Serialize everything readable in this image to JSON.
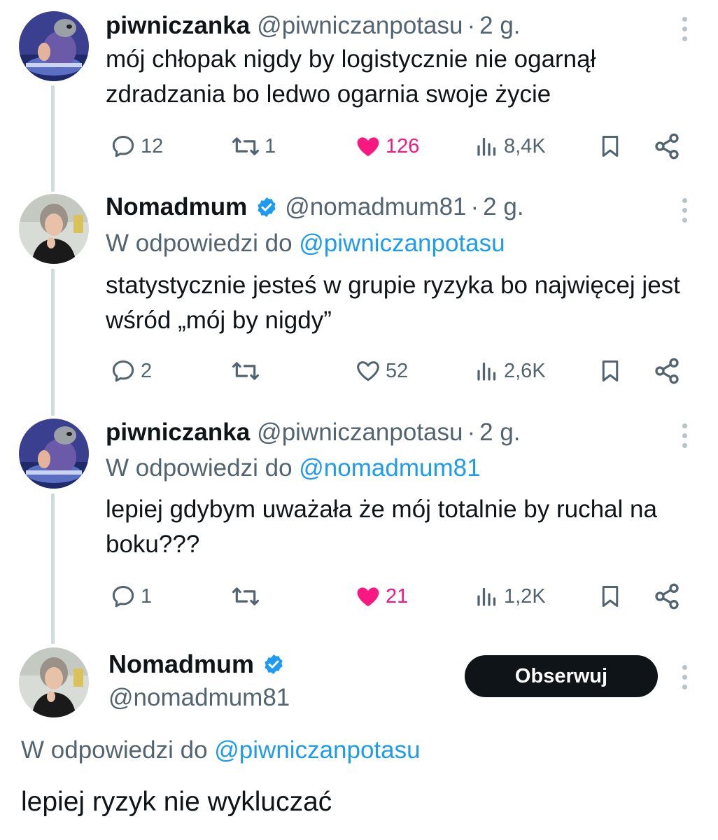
{
  "tweets": [
    {
      "name": "piwniczanka",
      "handle": "@piwniczanpotasu",
      "dot": "·",
      "time": "2 g.",
      "reply_prefix": "",
      "reply_mention": "",
      "text": "mój chłopak nigdy by logistycznie nie ogarnął zdradzania bo ledwo ogarnia swoje życie",
      "replies": "12",
      "retweets": "1",
      "likes": "126",
      "views": "8,4K",
      "liked": true,
      "verified": false
    },
    {
      "name": "Nomadmum",
      "handle": "@nomadmum81",
      "dot": "·",
      "time": "2 g.",
      "reply_prefix": "W odpowiedzi do",
      "reply_mention": "@piwniczanpotasu",
      "text": "statystycznie jesteś w grupie ryzyka bo najwięcej jest wśród „mój by nigdy”",
      "replies": "2",
      "retweets": "",
      "likes": "52",
      "views": "2,6K",
      "liked": false,
      "verified": true
    },
    {
      "name": "piwniczanka",
      "handle": "@piwniczanpotasu",
      "dot": "·",
      "time": "2 g.",
      "reply_prefix": "W odpowiedzi do",
      "reply_mention": "@nomadmum81",
      "text": "lepiej gdybym uważała że mój totalnie by ruchal na boku???",
      "replies": "1",
      "retweets": "",
      "likes": "21",
      "views": "1,2K",
      "liked": true,
      "verified": false
    }
  ],
  "main": {
    "name": "Nomadmum",
    "handle": "@nomadmum81",
    "follow_label": "Obserwuj",
    "reply_prefix": "W odpowiedzi do",
    "reply_mention": "@piwniczanpotasu",
    "text": "lepiej ryzyk nie wykluczać"
  },
  "colors": {
    "text": "#0f1419",
    "secondary": "#536471",
    "link": "#1d9bf0",
    "like": "#f91880",
    "verified": "#1d9bf0",
    "thread_line": "#cfd9de"
  },
  "icons": [
    "reply-icon",
    "retweet-icon",
    "heart-icon",
    "views-icon",
    "bookmark-icon",
    "share-icon",
    "more-icon",
    "verified-badge-icon"
  ]
}
